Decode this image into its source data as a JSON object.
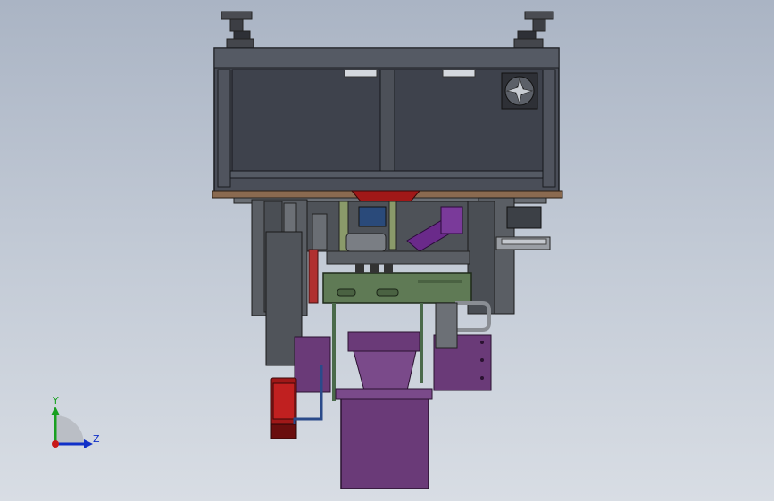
{
  "viewport": {
    "model_name": "",
    "background_top": "#aab4c4",
    "background_bottom": "#d8dde4"
  },
  "triad": {
    "y_label": "Y",
    "z_label": "Z",
    "y_color": "#18a020",
    "z_color": "#1030c8",
    "origin_color": "#c81818"
  },
  "icons": [
    "fan-icon"
  ],
  "colors": {
    "cabinet": "#4a4e58",
    "cabinet_panel": "#3e424c",
    "frame_dark": "#5a5e64",
    "purple": "#6a3a78",
    "plate_green": "#5f7a55",
    "red": "#a01818",
    "wood": "#8a6a50"
  }
}
